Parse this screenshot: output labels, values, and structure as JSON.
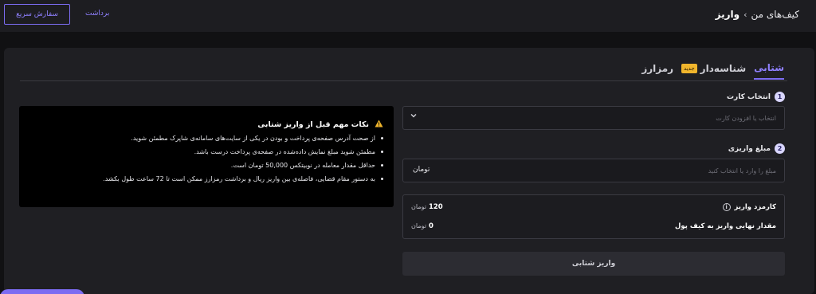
{
  "topbar": {
    "quick_order_label": "سفارش سریع",
    "withdraw_label": "برداشت",
    "breadcrumb": {
      "parent": "کیف‌های من",
      "separator": "›",
      "current": "واریز"
    }
  },
  "tabs": [
    {
      "label": "شتابی",
      "active": true
    },
    {
      "label": "شناسه‌دار",
      "badge": "جدید",
      "active": false
    },
    {
      "label": "رمزارز",
      "active": false
    }
  ],
  "step1": {
    "number": "1",
    "label": "انتخاب کارت",
    "placeholder": "انتخاب یا افزودن کارت"
  },
  "step2": {
    "number": "2",
    "label": "مبلغ واریزی",
    "placeholder": "مبلغ را وارد یا انتخاب کنید",
    "unit": "تومان"
  },
  "summary": {
    "fee_label": "کارمزد واریز",
    "fee_value": "120",
    "fee_currency": "تومان",
    "final_label": "مقدار نهایی واریز به کیف پول",
    "final_value": "0",
    "final_currency": "تومان"
  },
  "submit_label": "واریز شتابی",
  "notes": {
    "title": "نکات مهم قبل از واریز شتابی",
    "items": [
      "از صحت آدرس صفحه‌ی پرداخت و بودن در یکی از سایت‌های سامانه‌ی شاپرک مطمئن شوید.",
      "مطمئن شوید مبلغ نمایش داده‌شده در صفحه‌ی پرداخت درست باشد.",
      "حداقل مقدار معامله در نوبیتکس 50,000 تومان است.",
      "به دستور مقام قضایی، فاصله‌ی بین واریز ریال و برداشت رمزارز ممکن است تا 72 ساعت طول بکشد."
    ]
  },
  "colors": {
    "accent": "#7c6cf2",
    "warning": "#f0b52c",
    "badge": "#f0b52c"
  },
  "icons": {
    "warning": "warning-icon",
    "info": "info-icon",
    "chevron": "chevron-down-icon"
  }
}
